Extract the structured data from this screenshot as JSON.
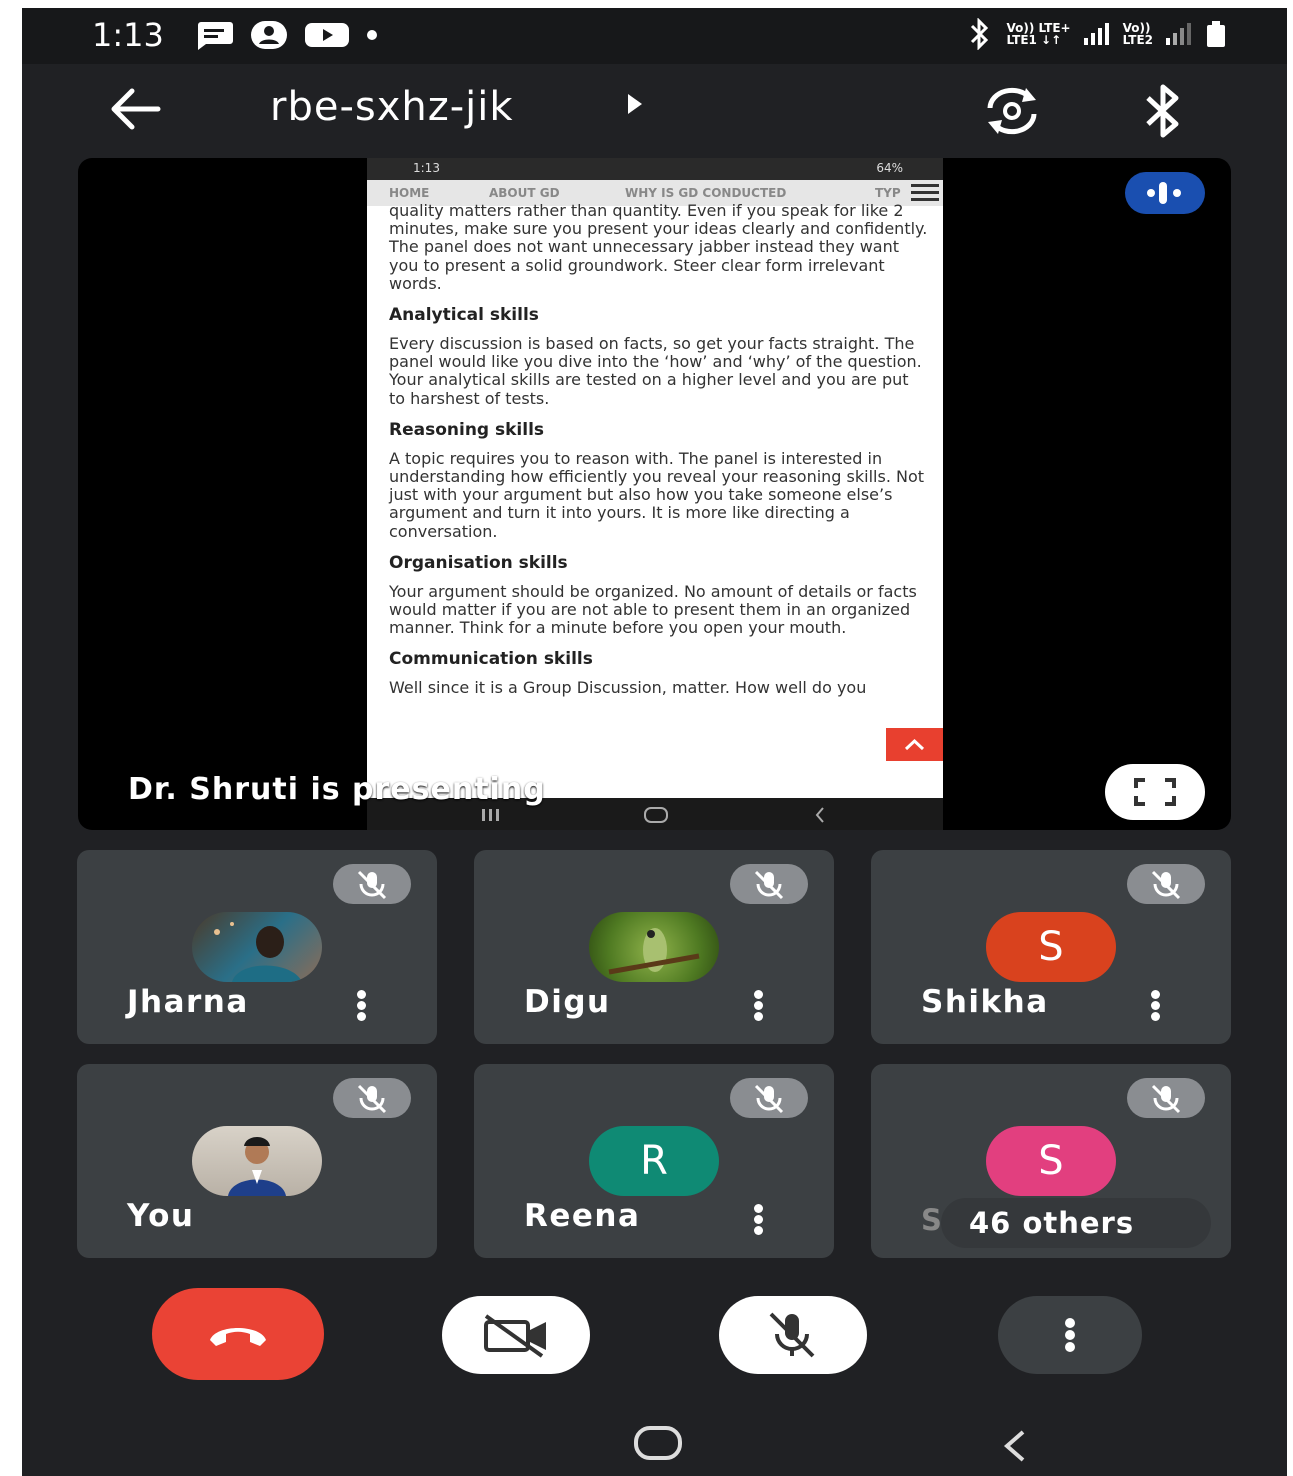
{
  "status_bar": {
    "time": "1:13",
    "net1": "Vo)) LTE+",
    "net1_sub": "LTE1 ↓↑",
    "net2": "Vo))",
    "net2_sub": "LTE2"
  },
  "header": {
    "meeting_code": "rbe-sxhz-jik"
  },
  "presentation": {
    "presenter_label": "Dr. Shruti is presenting",
    "shared_screen": {
      "status_time": "1:13",
      "status_right": "64%",
      "nav": [
        "HOME",
        "ABOUT GD",
        "WHY IS GD CONDUCTED",
        "TYP"
      ],
      "intro_text": "quality matters rather than quantity. Even if you speak for like 2 minutes, make sure you present your ideas clearly and confidently. The panel does not want unnecessary jabber instead they want you to present a solid groundwork. Steer clear form irrelevant words.",
      "sections": [
        {
          "heading": "Analytical skills",
          "text": "Every discussion is based on facts, so get your facts straight. The panel would like you dive into the ‘how’ and ‘why’ of the question. Your analytical skills are tested on a higher level and you are put to harshest of tests."
        },
        {
          "heading": "Reasoning skills",
          "text": "A topic requires you to reason with. The panel is interested in understanding how efficiently you reveal your reasoning skills. Not just with your argument but also how you take someone else’s argument and turn it into yours. It is more like directing a conversation."
        },
        {
          "heading": "Organisation skills",
          "text": "Your argument should be organized. No amount of details or facts would matter if you are not able to present them in an organized manner. Think for a minute before you open your mouth."
        },
        {
          "heading": "Communication skills",
          "text": "Well since it is a Group Discussion, matter. How well do you"
        }
      ]
    }
  },
  "participants": [
    {
      "name": "Jharna",
      "avatar": "photo",
      "color": "#2f6e8a"
    },
    {
      "name": "Digu",
      "avatar": "photo",
      "color": "#6a8f2a"
    },
    {
      "name": "Shikha",
      "avatar": "S",
      "color": "#d9421e"
    },
    {
      "name": "You",
      "avatar": "photo",
      "color": "#3a5a8a"
    },
    {
      "name": "Reena",
      "avatar": "R",
      "color": "#0f8a74"
    },
    {
      "name": "S",
      "avatar": "S",
      "color": "#e23f7f",
      "others_label": "46 others",
      "partial_name": "Sc"
    }
  ],
  "controls": {
    "end_call_color": "#ea4335"
  },
  "icons": [
    "message-icon",
    "account-icon",
    "youtube-icon",
    "bluetooth-icon",
    "signal-icon",
    "battery-icon",
    "back-arrow-icon",
    "switch-camera-icon",
    "mic-off-icon",
    "more-vert-icon",
    "fullscreen-icon",
    "video-off-icon",
    "end-call-icon",
    "home-nav-icon",
    "back-nav-icon"
  ]
}
